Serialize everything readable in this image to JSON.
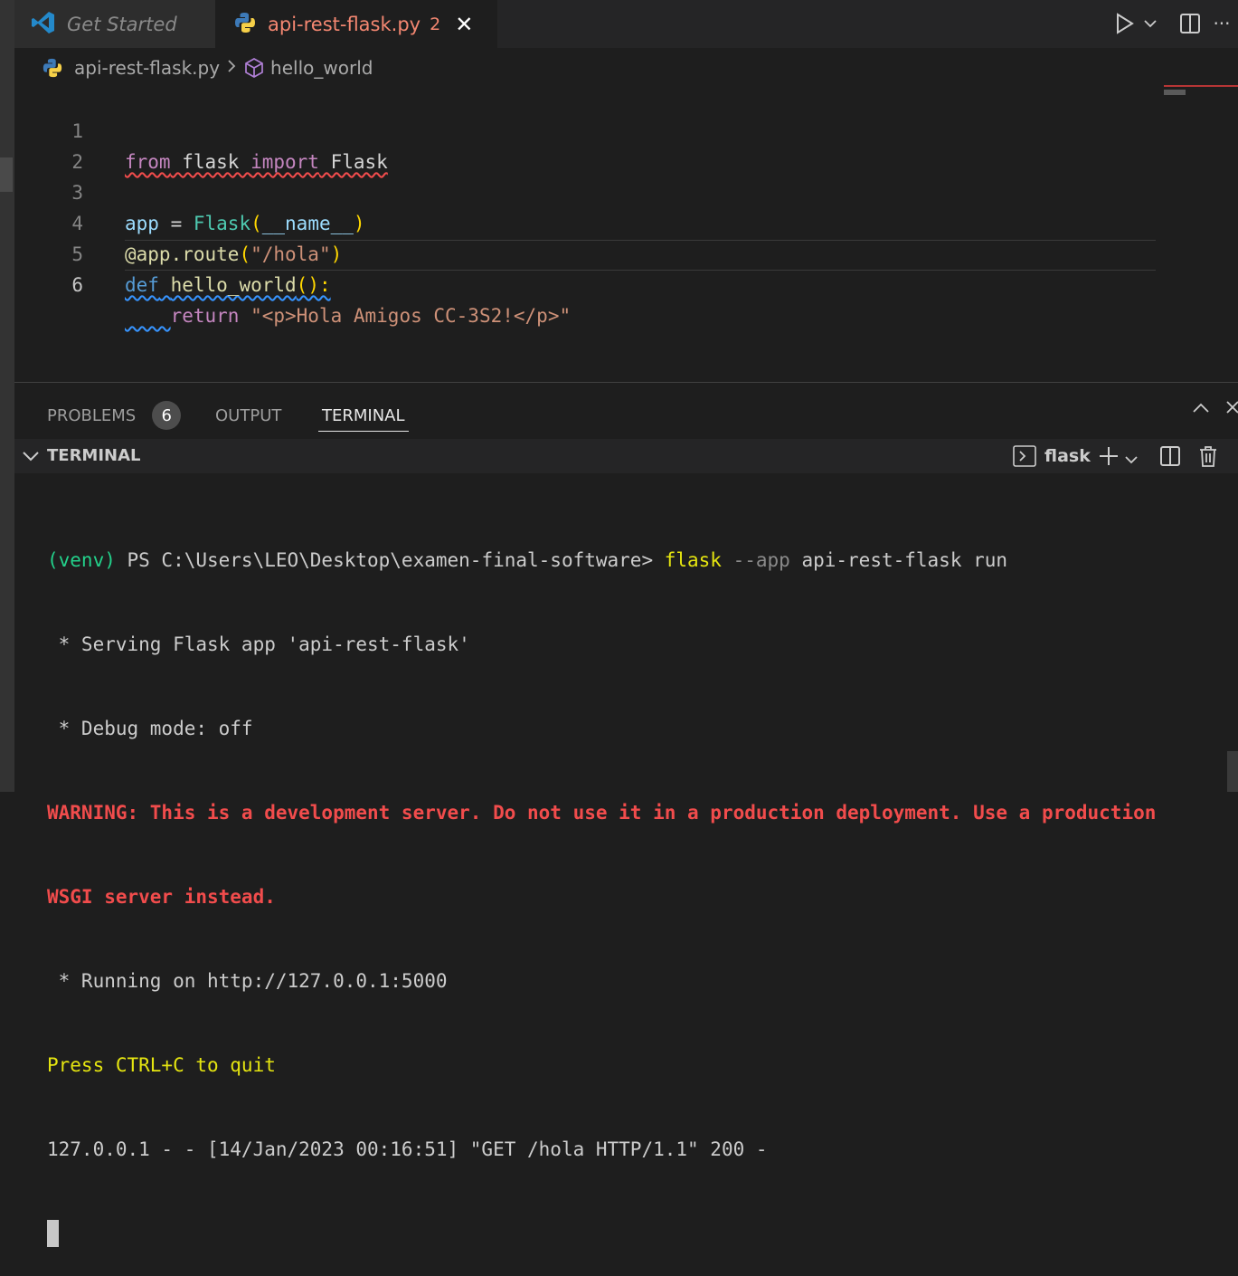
{
  "tabs": [
    {
      "label": "Get Started",
      "icon": "vscode-logo-icon"
    },
    {
      "label": "api-rest-flask.py",
      "icon": "python-icon",
      "problem_count": "2",
      "close": "✕"
    }
  ],
  "toolbar": {
    "run": "run-icon",
    "dropdown": "chevron-down-icon",
    "split": "split-editor-icon",
    "more": "···"
  },
  "breadcrumb": {
    "file": "api-rest-flask.py",
    "symbol": "hello_world"
  },
  "editor": {
    "line_numbers": [
      "1",
      "2",
      "3",
      "4",
      "5",
      "6"
    ],
    "lines": {
      "l1": [
        "from",
        " flask ",
        "import",
        " Flask"
      ],
      "l3": [
        "app",
        " = ",
        "Flask",
        "(",
        "__name__",
        ")"
      ],
      "l4": [
        "@app.route",
        "(",
        "\"/hola\"",
        ")"
      ],
      "l5": [
        "def",
        " ",
        "hello_world",
        "():"
      ],
      "l6": [
        "    ",
        "return",
        " ",
        "\"<p>Hola Amigos CC-3S2!</p>\""
      ]
    }
  },
  "panel": {
    "tabs": {
      "problems": "PROBLEMS",
      "problems_count": "6",
      "output": "OUTPUT",
      "terminal": "TERMINAL"
    },
    "section_title": "TERMINAL",
    "terminal_name": "flask"
  },
  "terminal": {
    "prompt_env": "(venv)",
    "prompt_path": " PS C:\\Users\\LEO\\Desktop\\examen-final-software> ",
    "cmd": "flask",
    "cmd_flag": " --app",
    "cmd_args": " api-rest-flask run",
    "serving": " * Serving Flask app 'api-rest-flask'",
    "debug": " * Debug mode: off",
    "warning_1": "WARNING: This is a development server. Do not use it in a production deployment. Use a production",
    "warning_2": "WSGI server instead.",
    "running": " * Running on http://127.0.0.1:5000",
    "quit": "Press CTRL+C to quit",
    "request": "127.0.0.1 - - [14/Jan/2023 00:16:51] \"GET /hola HTTP/1.1\" 200 -"
  },
  "colors": {
    "error": "#f14c4c",
    "accent": "#3794ff",
    "terminal_green": "#23d18b",
    "terminal_yellow": "#e5e510"
  }
}
